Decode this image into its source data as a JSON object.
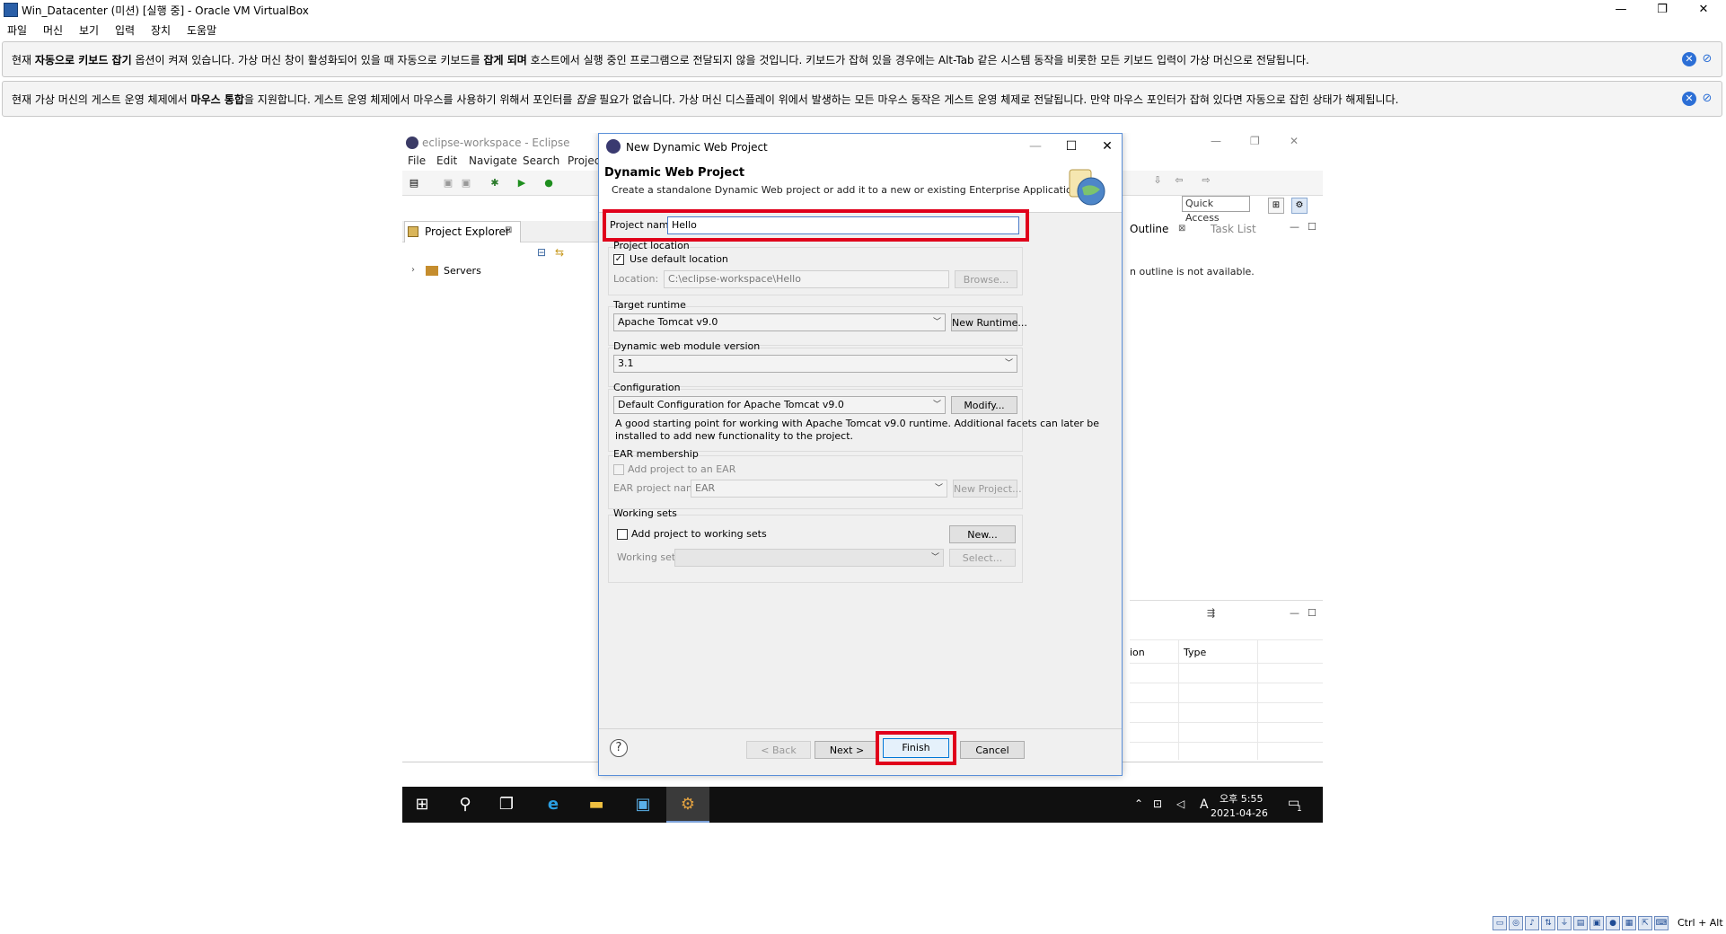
{
  "vbox": {
    "window_title": "Win_Datacenter (미션) [실행 중] - Oracle VM VirtualBox",
    "controls": {
      "minimize": "—",
      "restore": "❐",
      "close": "✕"
    },
    "menu": [
      "파일",
      "머신",
      "보기",
      "입력",
      "장치",
      "도움말"
    ],
    "notice_keyboard": {
      "p1": "현재 ",
      "b1": "자동으로 키보드 잡기",
      "p2": " 옵션이 켜져 있습니다. 가상 머신 창이 활성화되어 있을 때 자동으로 키보드를 ",
      "b2": "잡게 되며",
      "p3": " 호스트에서 실행 중인 프로그램으로 전달되지 않을 것입니다. 키보드가 잡혀 있을 경우에는 Alt-Tab 같은 시스템 동작을 비롯한 모든 키보드 입력이 가상 머신으로 전달됩니다."
    },
    "notice_mouse": {
      "p1": "현재 가상 머신의 게스트 운영 체제에서 ",
      "b1": "마우스 통합",
      "p2": "을 지원합니다. 게스트 운영 체제에서 마우스를 사용하기 위해서 포인터를 ",
      "i1": "잡을",
      "p3": " 필요가 없습니다. 가상 머신 디스플레이 위에서 발생하는 모든 마우스 동작은 게스트 운영 체제로 전달됩니다. 만약 마우스 포인터가 잡혀 있다면 자동으로 잡힌 상태가 해제됩니다."
    },
    "host_key": "Ctrl + Alt"
  },
  "eclipse": {
    "title": "eclipse-workspace - Eclipse",
    "menu": [
      "File",
      "Edit",
      "Navigate",
      "Search",
      "Project"
    ],
    "quick_access": "Quick Access",
    "project_explorer_tab": "Project Explorer",
    "servers": "Servers",
    "outline_tab": "Outline",
    "task_list_tab": "Task List",
    "outline_message": "n outline is not available.",
    "columns": {
      "c1": "ion",
      "c2": "Type"
    },
    "window_controls": {
      "minimize": "—",
      "restore": "❐",
      "close": "✕"
    }
  },
  "dialog": {
    "title": "New Dynamic Web Project",
    "header_title": "Dynamic Web Project",
    "header_desc": "Create a standalone Dynamic Web project or add it to a new or existing Enterprise Application.",
    "project_name_label": "Project name:",
    "project_name_value": "Hello",
    "project_location": {
      "group_label": "Project location",
      "use_default_label": "Use default location",
      "use_default_checked": true,
      "location_label": "Location:",
      "location_value": "C:\\eclipse-workspace\\Hello",
      "browse_label": "Browse..."
    },
    "target_runtime": {
      "group_label": "Target runtime",
      "selected": "Apache Tomcat v9.0",
      "new_runtime_label": "New Runtime..."
    },
    "module_version": {
      "group_label": "Dynamic web module version",
      "selected": "3.1"
    },
    "configuration": {
      "group_label": "Configuration",
      "selected": "Default Configuration for Apache Tomcat v9.0",
      "modify_label": "Modify...",
      "description_1": "A good starting point for working with Apache Tomcat v9.0 runtime. Additional facets can later be",
      "description_2": "installed to add new functionality to the project."
    },
    "ear": {
      "group_label": "EAR membership",
      "add_label": "Add project to an EAR",
      "name_label": "EAR project name:",
      "name_value": "EAR",
      "new_project_label": "New Project..."
    },
    "working_sets": {
      "group_label": "Working sets",
      "add_label": "Add project to working sets",
      "new_label": "New...",
      "sets_label": "Working sets:",
      "select_label": "Select..."
    },
    "buttons": {
      "help": "?",
      "back": "< Back",
      "next": "Next >",
      "finish": "Finish",
      "cancel": "Cancel"
    },
    "controls": {
      "minimize": "—",
      "maximize": "☐",
      "close": "✕"
    },
    "highlight_color": "#e0001b"
  },
  "taskbar": {
    "time": "오후 5:55",
    "date": "2021-04-26",
    "ime": "A",
    "notification_count": "1"
  }
}
